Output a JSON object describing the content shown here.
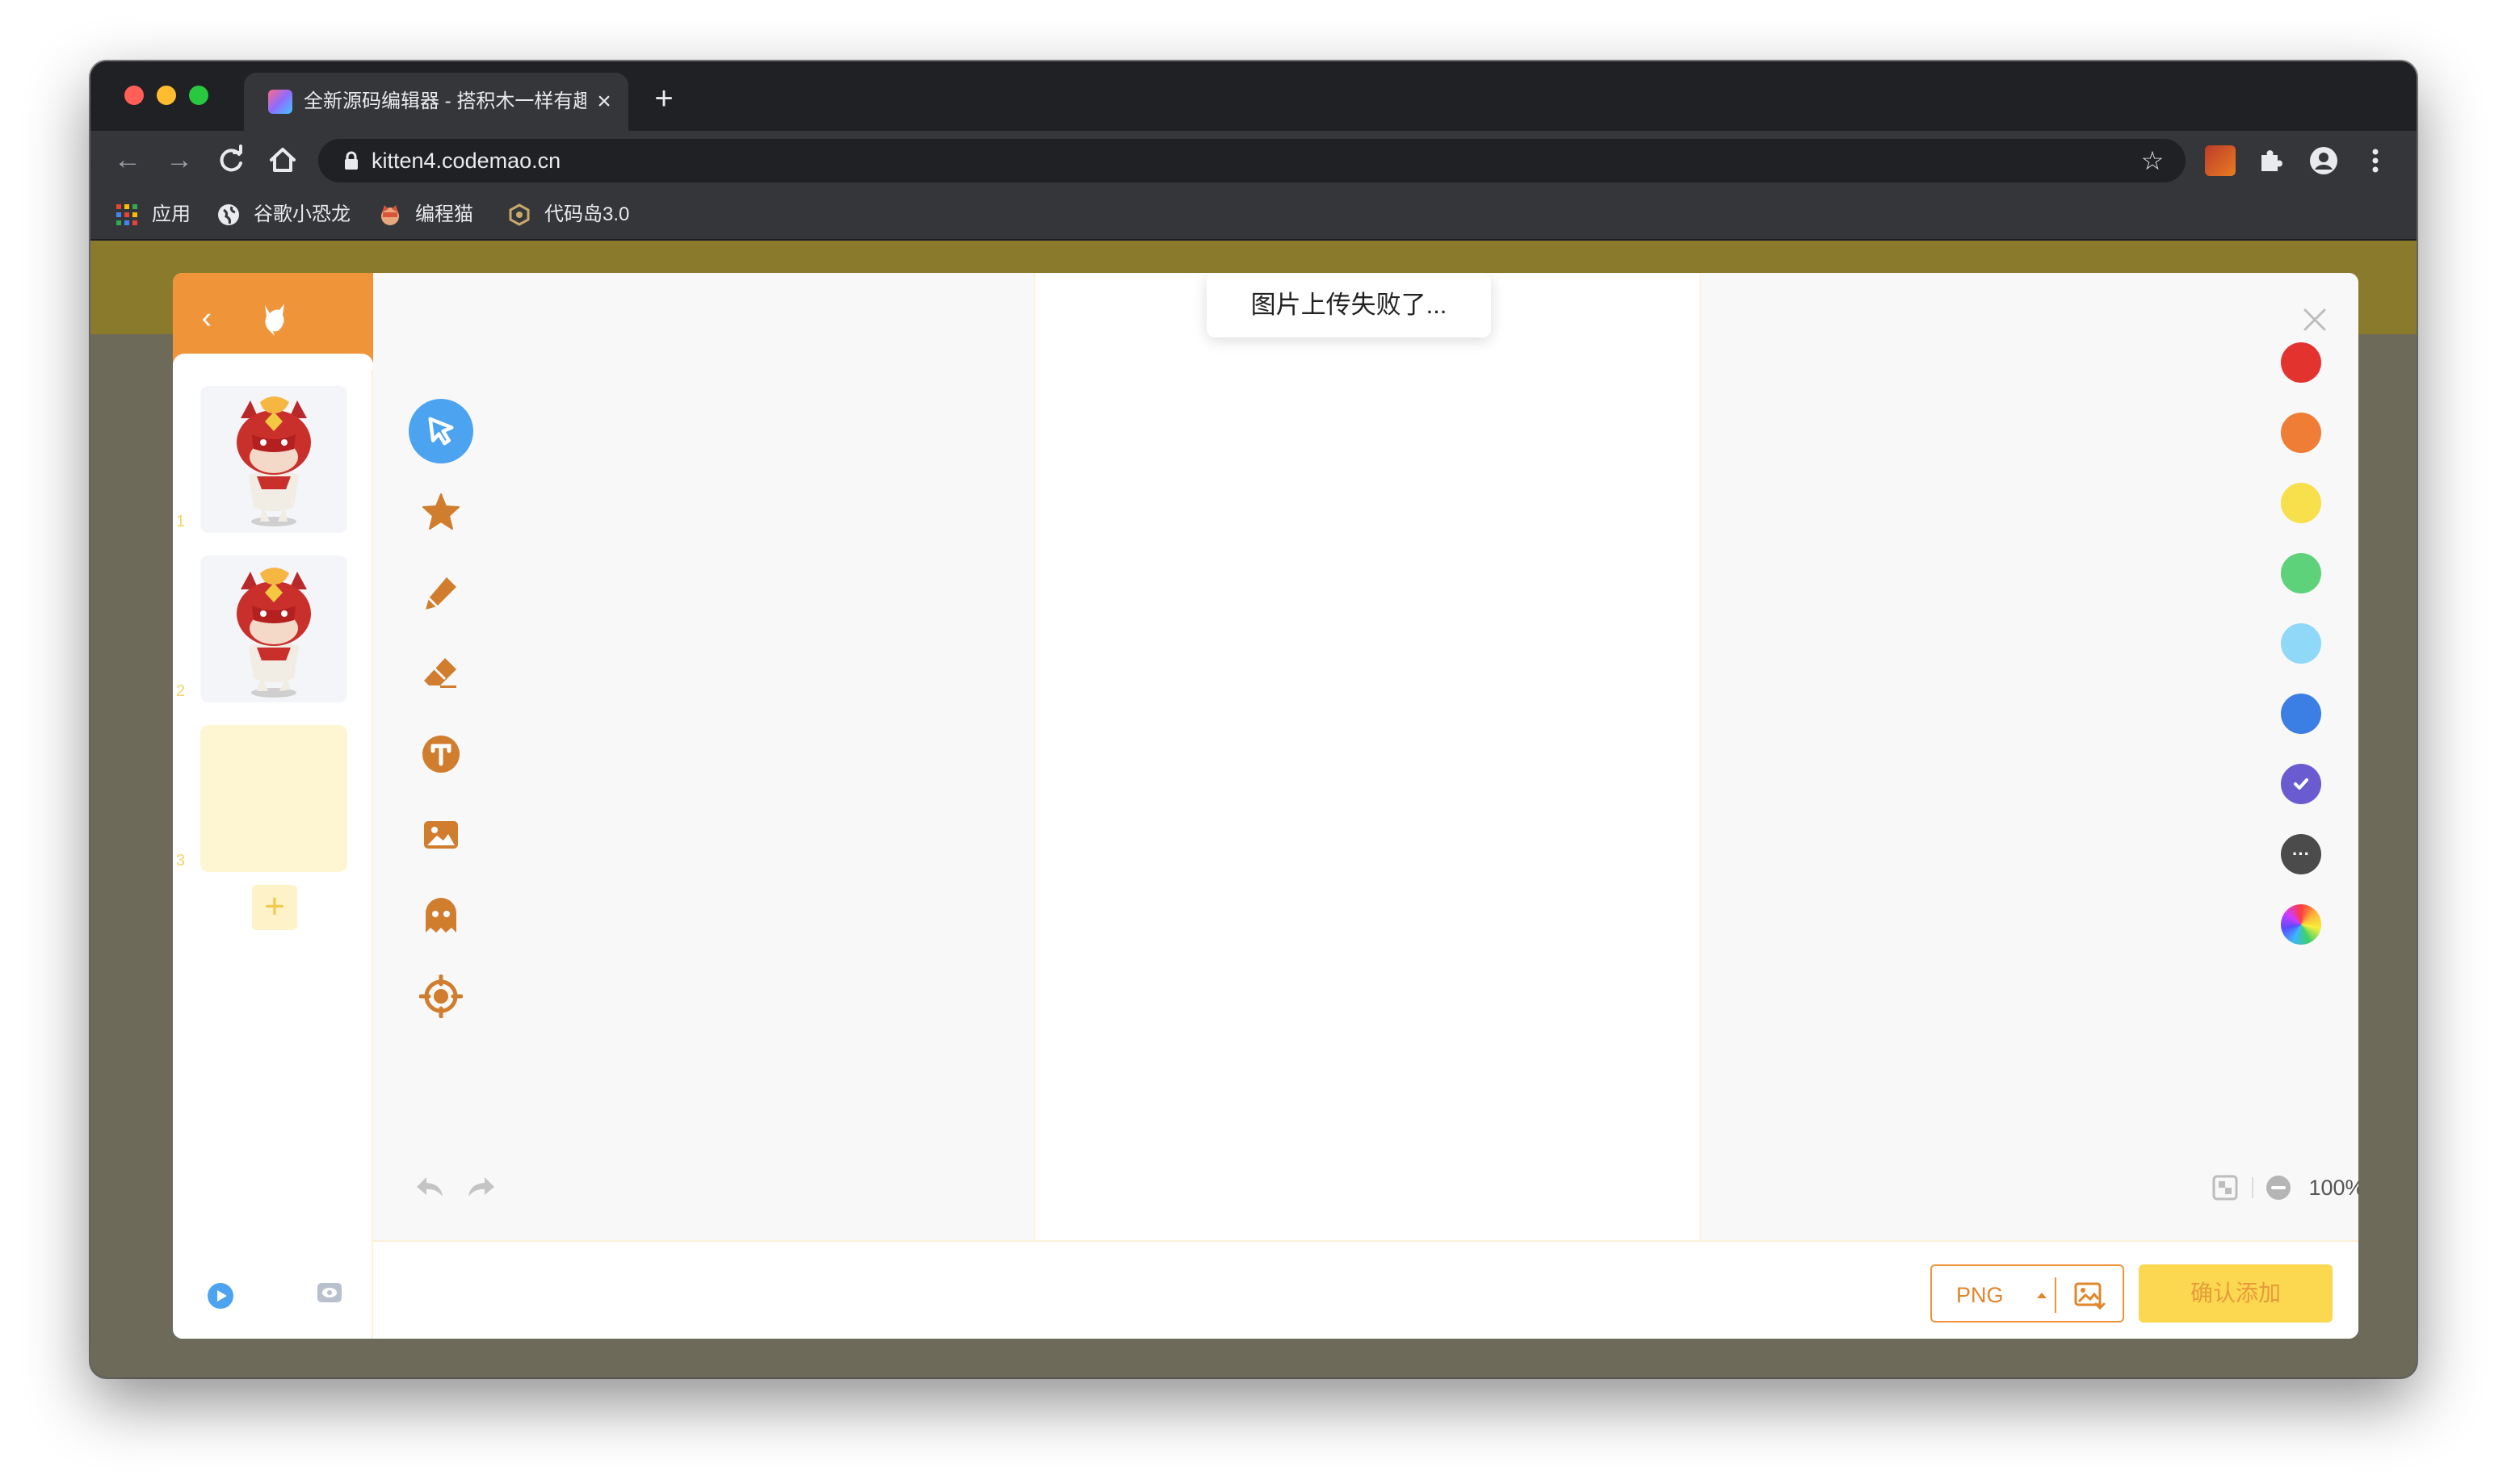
{
  "browser": {
    "tab_title": "全新源码编辑器 - 搭积木一样有趣",
    "tab_close_icon": "close-icon",
    "new_tab_icon": "plus-icon",
    "url": "kitten4.codemao.cn",
    "bookmarks": [
      {
        "label": "应用",
        "icon": "apps-grid-icon"
      },
      {
        "label": "谷歌小恐龙",
        "icon": "globe-icon"
      },
      {
        "label": "编程猫",
        "icon": "codemao-cat-icon"
      },
      {
        "label": "代码岛3.0",
        "icon": "code-island-icon"
      }
    ]
  },
  "editor": {
    "toast": "图片上传失败了...",
    "costumes": [
      {
        "number": "1",
        "image": "red-fox-character-pose-a"
      },
      {
        "number": "2",
        "image": "red-fox-character-pose-b"
      },
      {
        "number": "3",
        "image": "empty"
      }
    ],
    "tools": [
      "select-arrow-icon",
      "star-icon",
      "pencil-icon",
      "eraser-icon",
      "text-icon",
      "image-icon",
      "ghost-icon",
      "center-target-icon"
    ],
    "palette": [
      {
        "name": "red",
        "color": "#e3332f"
      },
      {
        "name": "orange",
        "color": "#ef7d35"
      },
      {
        "name": "yellow",
        "color": "#f7e04c"
      },
      {
        "name": "green",
        "color": "#5ed17b"
      },
      {
        "name": "light-blue",
        "color": "#8fd8f8"
      },
      {
        "name": "blue",
        "color": "#3b7ee4"
      },
      {
        "name": "purple",
        "color": "#6b5bd0",
        "selected": true
      },
      {
        "name": "dark-gray",
        "color": "#4b4b4b",
        "label": "···"
      },
      {
        "name": "custom",
        "color": "conic-gradient"
      }
    ],
    "zoom": "100%",
    "format": "PNG",
    "confirm_label": "确认添加"
  },
  "colors": {
    "accent_orange": "#f0943a",
    "confirm_yellow": "#fbd850",
    "select_blue": "#4ca3f0",
    "tool_brown": "#d07d2e"
  }
}
